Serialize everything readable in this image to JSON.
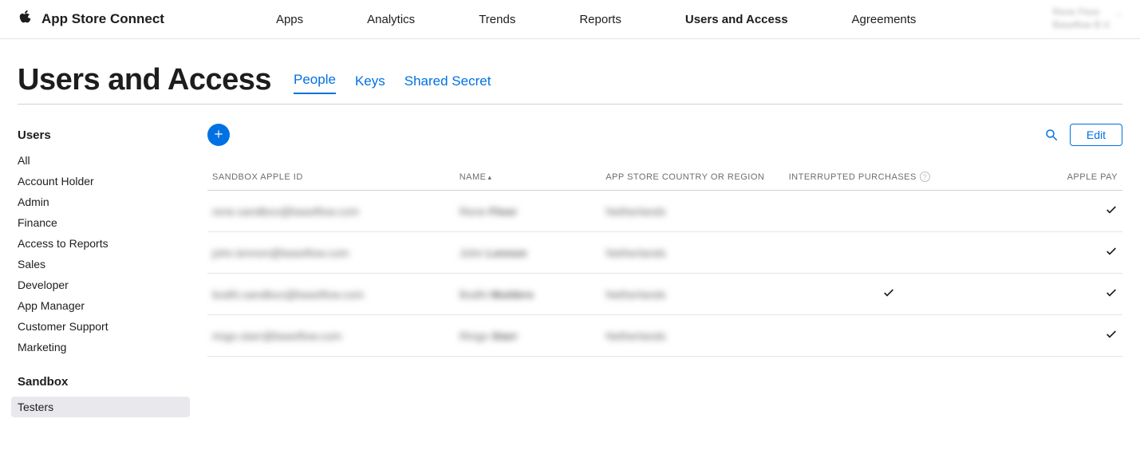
{
  "brand": "App Store Connect",
  "nav": {
    "items": [
      "Apps",
      "Analytics",
      "Trends",
      "Reports",
      "Users and Access",
      "Agreements"
    ],
    "active_index": 4
  },
  "account": {
    "line1": "Rene Floor",
    "line2": "Baseflow B.V."
  },
  "page_title": "Users and Access",
  "subtabs": {
    "items": [
      "People",
      "Keys",
      "Shared Secret"
    ],
    "active_index": 0
  },
  "sidebar": {
    "section1_heading": "Users",
    "section1_items": [
      "All",
      "Account Holder",
      "Admin",
      "Finance",
      "Access to Reports",
      "Sales",
      "Developer",
      "App Manager",
      "Customer Support",
      "Marketing"
    ],
    "section2_heading": "Sandbox",
    "section2_items": [
      "Testers"
    ],
    "selected": "Testers"
  },
  "toolbar": {
    "edit_label": "Edit"
  },
  "table": {
    "headers": {
      "sandbox_id": "SANDBOX APPLE ID",
      "name": "NAME",
      "region": "APP STORE COUNTRY OR REGION",
      "interrupted": "INTERRUPTED PURCHASES",
      "apple_pay": "APPLE PAY"
    },
    "sort_column": "name",
    "rows": [
      {
        "id": "rene.sandbox@baseflow.com",
        "first": "Rene",
        "last": "Floor",
        "region": "Netherlands",
        "interrupted": false,
        "apple_pay": true
      },
      {
        "id": "john.lennon@baseflow.com",
        "first": "John",
        "last": "Lennon",
        "region": "Netherlands",
        "interrupted": false,
        "apple_pay": true
      },
      {
        "id": "bodhi.sandbox@baseflow.com",
        "first": "Bodhi",
        "last": "Mulders",
        "region": "Netherlands",
        "interrupted": true,
        "apple_pay": true
      },
      {
        "id": "ringo.starr@baseflow.com",
        "first": "Ringo",
        "last": "Starr",
        "region": "Netherlands",
        "interrupted": false,
        "apple_pay": true
      }
    ]
  }
}
